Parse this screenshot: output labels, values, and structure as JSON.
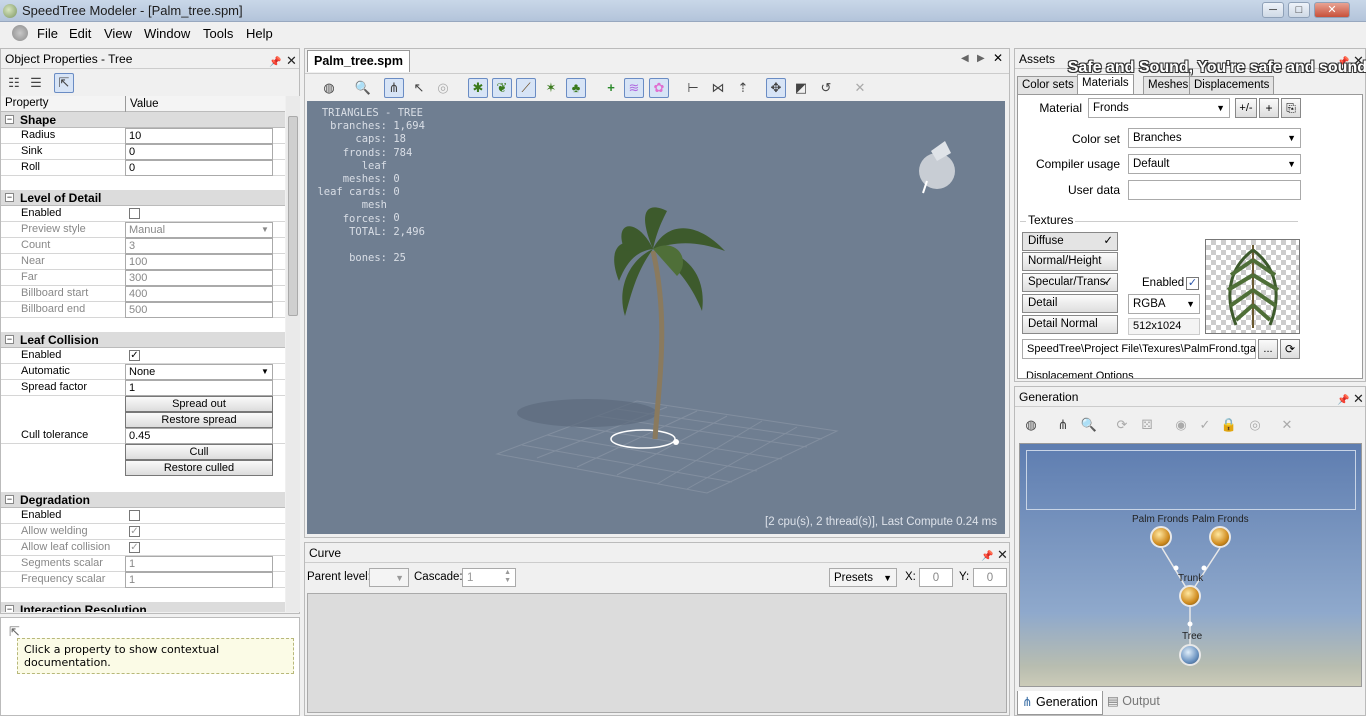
{
  "window": {
    "title": "SpeedTree Modeler - [Palm_tree.spm]",
    "min": "─",
    "max": "□",
    "close": "✕"
  },
  "menu": {
    "items": [
      "File",
      "Edit",
      "View",
      "Window",
      "Tools",
      "Help"
    ]
  },
  "left": {
    "header": "Object Properties - Tree",
    "col_property": "Property",
    "col_value": "Value",
    "shape": {
      "title": "Shape",
      "rows": [
        [
          "Radius",
          "10"
        ],
        [
          "Sink",
          "0"
        ],
        [
          "Roll",
          "0"
        ]
      ]
    },
    "lod": {
      "title": "Level of Detail",
      "enabled_label": "Enabled",
      "enabled": false,
      "preview_label": "Preview style",
      "preview_value": "Manual",
      "rows": [
        [
          "Count",
          "3"
        ],
        [
          "Near",
          "100"
        ],
        [
          "Far",
          "300"
        ],
        [
          "Billboard start",
          "400"
        ],
        [
          "Billboard end",
          "500"
        ]
      ]
    },
    "leaf": {
      "title": "Leaf Collision",
      "enabled_label": "Enabled",
      "enabled_check": "✓",
      "automatic_label": "Automatic",
      "automatic_value": "None",
      "spread_label": "Spread factor",
      "spread_value": "1",
      "spread_out": "Spread out",
      "restore_spread": "Restore spread",
      "cull_label": "Cull tolerance",
      "cull_value": "0.45",
      "cull": "Cull",
      "restore_culled": "Restore culled"
    },
    "degradation": {
      "title": "Degradation",
      "enabled_label": "Enabled",
      "allow_welding": "Allow welding",
      "allow_leaf": "Allow leaf collision",
      "check": "✓",
      "rows": [
        [
          "Segments scalar",
          "1"
        ],
        [
          "Frequency scalar",
          "1"
        ]
      ]
    },
    "next_section": "Interaction Resolution",
    "help_text": "Click a property to show contextual documentation."
  },
  "document": {
    "tab": "Palm_tree.spm",
    "stats": [
      [
        "TRIANGLES - TREE",
        ""
      ],
      [
        "branches:",
        "1,694"
      ],
      [
        "caps:",
        "18"
      ],
      [
        "fronds:",
        "784"
      ],
      [
        "leaf meshes:",
        "0"
      ],
      [
        "leaf cards:",
        "0"
      ],
      [
        "mesh forces:",
        "0"
      ],
      [
        "TOTAL:",
        "2,496"
      ],
      [
        "",
        ""
      ],
      [
        "bones:",
        "25"
      ]
    ],
    "compute": "[2 cpu(s), 2 thread(s)], Last Compute 0.24 ms"
  },
  "curve": {
    "title": "Curve",
    "parent_level": "Parent level:",
    "cascade": "Cascade:",
    "cascade_value": "1",
    "presets": "Presets",
    "x_label": "X:",
    "x_value": "0",
    "y_label": "Y:",
    "y_value": "0"
  },
  "assets": {
    "title": "Assets",
    "overlay": "Safe and Sound, You're safe and sound",
    "tabs": [
      "Color sets",
      "Materials",
      "Meshes",
      "Displacements"
    ],
    "material_label": "Material",
    "material_value": "Fronds",
    "material_btns": [
      "+/-",
      "+",
      "⎘"
    ],
    "colorset_label": "Color set",
    "colorset_value": "Branches",
    "compiler_label": "Compiler usage",
    "compiler_value": "Default",
    "userdata_label": "User data",
    "userdata_value": "",
    "textures_label": "Textures",
    "tex_buttons": [
      "Diffuse",
      "Normal/Height",
      "Specular/Trans.",
      "Detail",
      "Detail Normal"
    ],
    "tex_checks": [
      "✓",
      "",
      "✓",
      "",
      ""
    ],
    "enabled_label": "Enabled",
    "format": "RGBA",
    "size": "512x1024",
    "path": "SpeedTree\\Project File\\Texures\\PalmFrond.tga",
    "browse": "...",
    "displacement": "Displacement Options"
  },
  "generation": {
    "title": "Generation",
    "nodes": [
      "Palm Fronds",
      "Palm Fronds",
      "Trunk",
      "Tree"
    ],
    "bottom_tabs": [
      "Generation",
      "Output"
    ]
  }
}
